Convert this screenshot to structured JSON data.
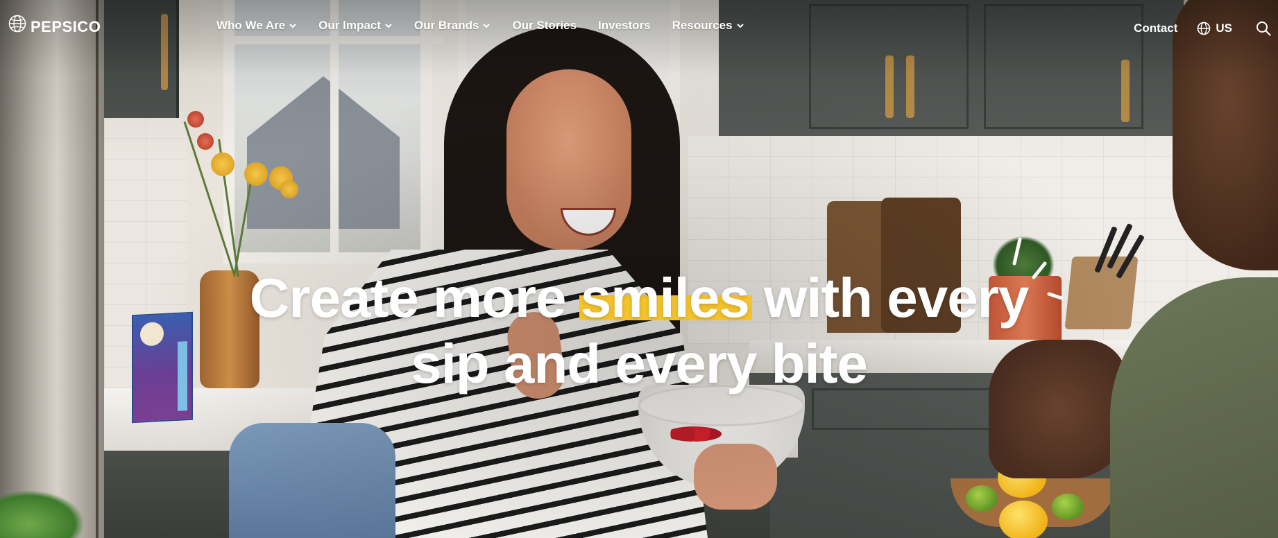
{
  "brand": {
    "name": "PEPSICO"
  },
  "nav": {
    "items": [
      {
        "label": "Who We Are",
        "has_dropdown": true
      },
      {
        "label": "Our Impact",
        "has_dropdown": true
      },
      {
        "label": "Our Brands",
        "has_dropdown": true
      },
      {
        "label": "Our Stories",
        "has_dropdown": false
      },
      {
        "label": "Investors",
        "has_dropdown": false
      },
      {
        "label": "Resources",
        "has_dropdown": true
      }
    ]
  },
  "utility": {
    "contact_label": "Contact",
    "locale_label": "US",
    "locale_icon": "globe-icon",
    "search_icon": "search-icon"
  },
  "hero": {
    "headline_part1": "Create more ",
    "headline_highlight": "smiles",
    "headline_part2": " with every",
    "headline_line2": "sip and every bite",
    "highlight_color": "#f4c32d",
    "text_color": "#ffffff"
  }
}
